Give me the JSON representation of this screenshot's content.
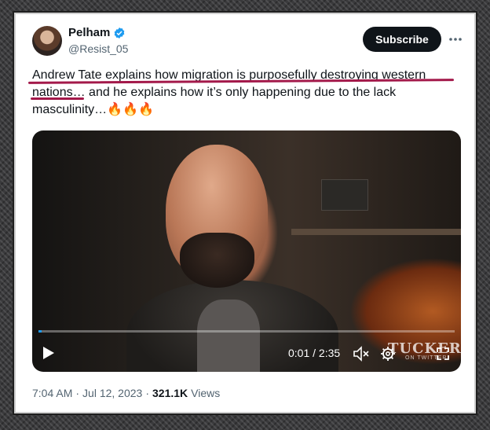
{
  "author": {
    "display_name": "Pelham",
    "handle": "@Resist_05",
    "verified": true
  },
  "header": {
    "subscribe_label": "Subscribe",
    "more_icon": "more-horizontal-icon"
  },
  "tweet": {
    "text_part1": "Andrew Tate explains how migration is purposefully destroying western",
    "text_part2": "nations…",
    "text_part3": " and he explains how it’s only happening due to the lack masculinity…🔥🔥🔥"
  },
  "video": {
    "current_time": "0:01",
    "separator": " / ",
    "duration": "2:35",
    "progress": 0.007,
    "watermark": "TUCKER",
    "watermark_sub": "ON TWITTER",
    "icons": [
      "play-icon",
      "mute-icon",
      "settings-icon",
      "fullscreen-icon"
    ]
  },
  "meta": {
    "time": "7:04 AM",
    "dot": "·",
    "date": "Jul 12, 2023",
    "dot2": "·",
    "views_count": "321.1K",
    "views_label": "Views"
  },
  "colors": {
    "verified_blue": "#1d9bf0",
    "annotation_underline": "#a3194a",
    "button_dark": "#0f1419"
  }
}
